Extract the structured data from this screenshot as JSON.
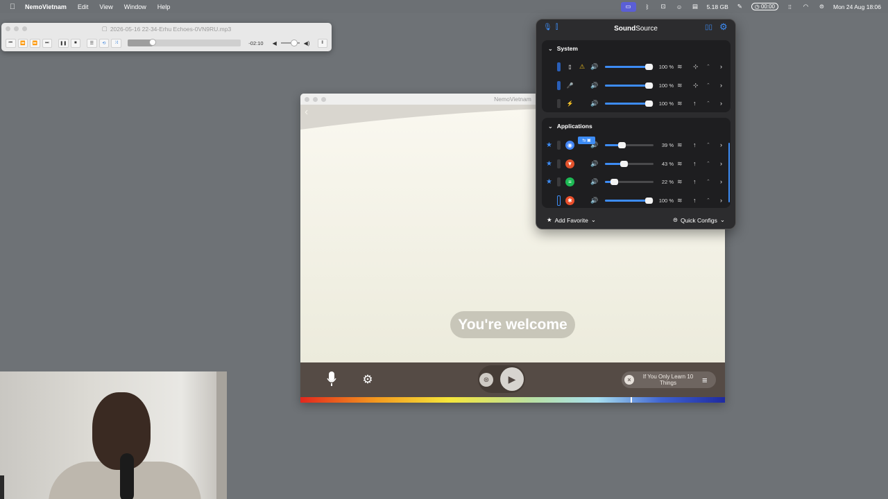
{
  "menubar": {
    "app": "NemoVietnam",
    "items": [
      "Edit",
      "View",
      "Window",
      "Help"
    ],
    "memory": "5.18 GB",
    "timer": "00:00",
    "datetime": "Mon 24 Aug  18:06"
  },
  "player": {
    "filename": "2026-05-16 22-34-Erhu Echoes-0VN9RU.mp3",
    "remaining": "-02:10",
    "progress": 0.21
  },
  "nemo": {
    "window_title": "NemoVietnam",
    "phrase": "You're welcome",
    "lesson": "If You Only Learn 10 Things"
  },
  "soundsource": {
    "title_bold": "Sound",
    "title_rest": "Source",
    "system_header": "System",
    "apps_header": "Applications",
    "system_rows": [
      {
        "device": "speaker-device-icon",
        "pct": "100 %",
        "level": 1.0
      },
      {
        "device": "microphone-icon",
        "pct": "100 %",
        "level": 1.0
      },
      {
        "device": "bolt-icon",
        "pct": "100 %",
        "level": 1.0
      }
    ],
    "app_rows": [
      {
        "app": "chrome",
        "pct": "39 %",
        "level": 0.39,
        "color": "#4285f4"
      },
      {
        "app": "brave",
        "pct": "43 %",
        "level": 0.43,
        "color": "#e2532d"
      },
      {
        "app": "spotify",
        "pct": "22 %",
        "level": 0.22,
        "color": "#1db954"
      },
      {
        "app": "app",
        "pct": "100 %",
        "level": 1.0,
        "color": "#e94e2b"
      }
    ],
    "add_favorite": "Add Favorite",
    "quick_configs": "Quick Configs"
  },
  "colors": {
    "accent": "#3d8cf5",
    "nemo_bar": "#554b45"
  }
}
